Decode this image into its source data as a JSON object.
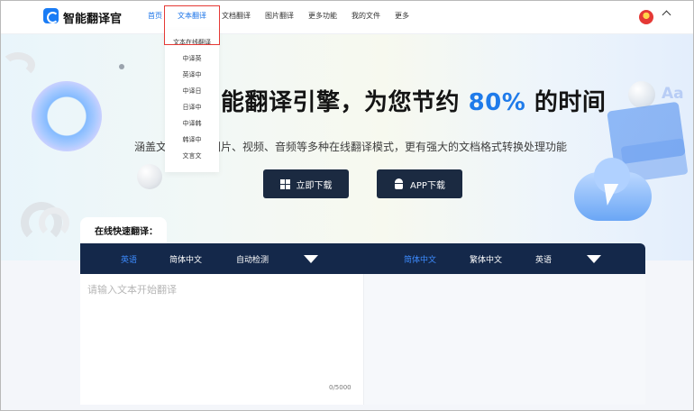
{
  "app": {
    "brand": "智能翻译官"
  },
  "nav": {
    "items": [
      {
        "label": "首页"
      },
      {
        "label": "文本翻译"
      },
      {
        "label": "文档翻译"
      },
      {
        "label": "图片翻译"
      },
      {
        "label": "更多功能"
      },
      {
        "label": "我的文件"
      },
      {
        "label": "更多"
      }
    ]
  },
  "dropdown": {
    "items": [
      {
        "label": "文本在线翻译"
      },
      {
        "label": "中译英"
      },
      {
        "label": "英译中"
      },
      {
        "label": "中译日"
      },
      {
        "label": "日译中"
      },
      {
        "label": "中译韩"
      },
      {
        "label": "韩译中"
      },
      {
        "label": "文言文"
      }
    ]
  },
  "hero": {
    "title_prefix": "能翻译引擎，为您节约 ",
    "title_pct": "80%",
    "title_suffix": " 的时间",
    "subtitle": "涵盖文　　　　图片、视频、音频等多种在线翻译模式，更有强大的文档格式转换处理功能",
    "btn_windows": "立即下载",
    "btn_app": "APP下载",
    "deco_text": "Aa"
  },
  "translate": {
    "title": "在线快速翻译：",
    "source_langs": [
      "英语",
      "简体中文",
      "自动检测"
    ],
    "target_langs": [
      "简体中文",
      "繁体中文",
      "英语"
    ],
    "input_placeholder": "请输入文本开始翻译",
    "input_value": "",
    "counter": "0/5000"
  },
  "colors": {
    "accent": "#1a73e8",
    "nav_bar": "#14284a",
    "button_dark": "#1b2a41",
    "highlight_border": "#e53935"
  }
}
